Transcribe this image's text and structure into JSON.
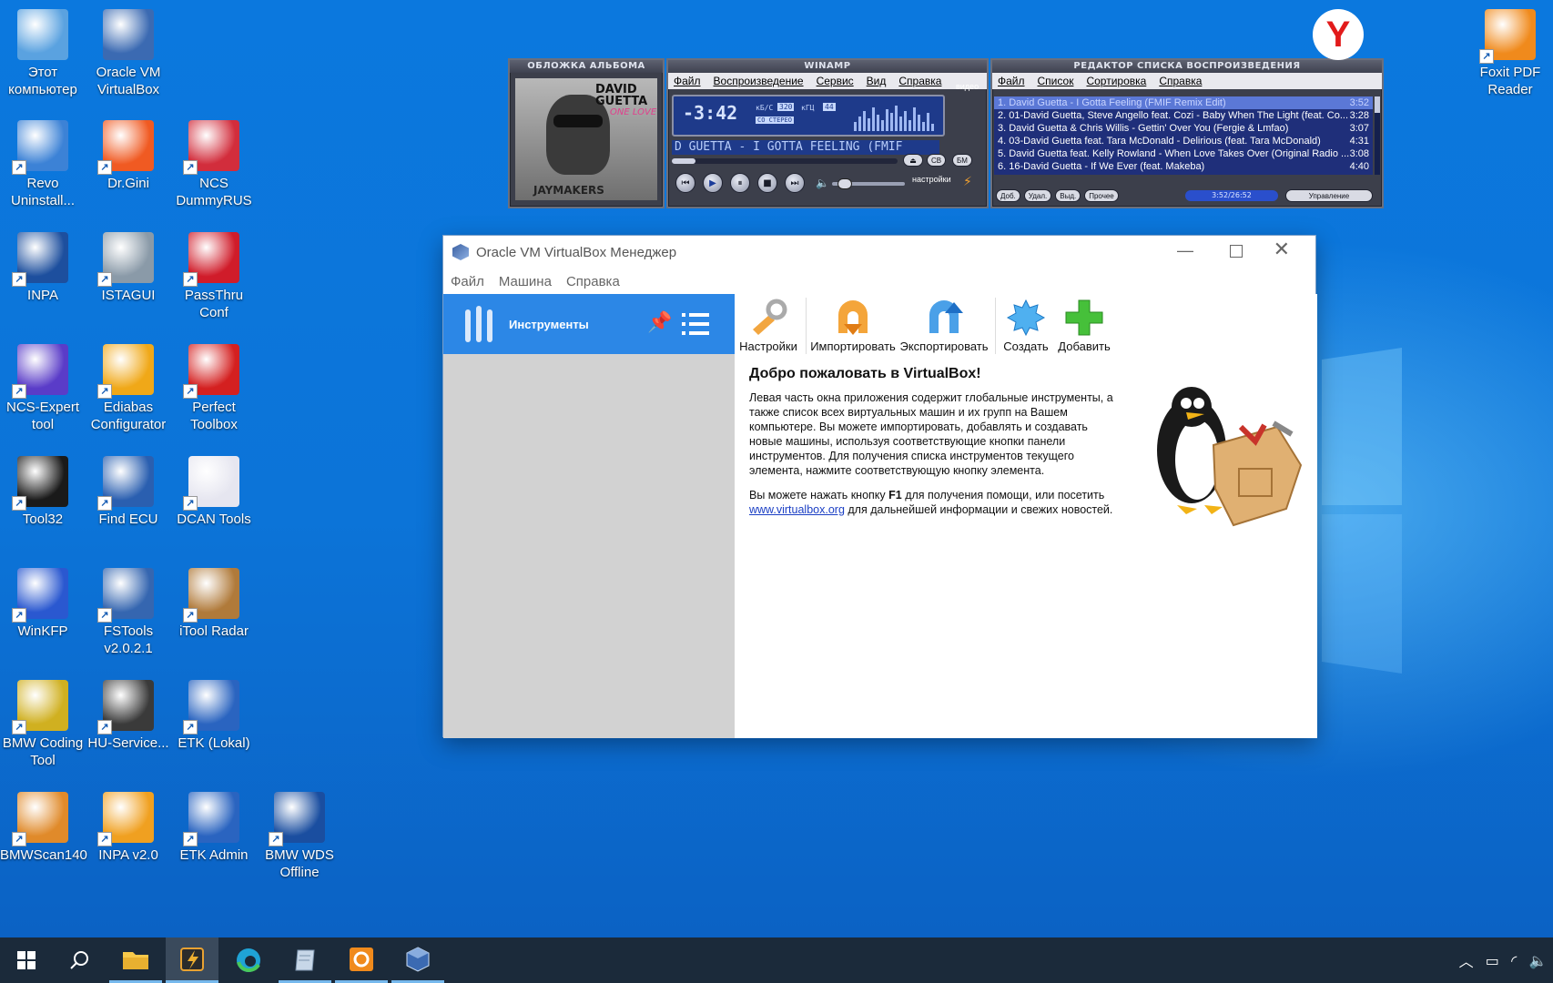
{
  "desktop": {
    "icons": [
      {
        "label": "Этот компьютер",
        "name": "this-pc"
      },
      {
        "label": "Oracle VM VirtualBox",
        "name": "virtualbox"
      },
      {
        "label": "Revo Uninstall...",
        "name": "revo-uninstaller"
      },
      {
        "label": "Dr.Gini",
        "name": "dr-gini"
      },
      {
        "label": "NCS DummyRUS",
        "name": "ncs-dummy"
      },
      {
        "label": "INPA",
        "name": "inpa"
      },
      {
        "label": "ISTAGUI",
        "name": "istagui"
      },
      {
        "label": "PassThru Conf",
        "name": "passthru-conf"
      },
      {
        "label": "NCS-Expert tool",
        "name": "ncs-expert"
      },
      {
        "label": "Ediabas Configurator",
        "name": "ediabas-configurator"
      },
      {
        "label": "Perfect Toolbox",
        "name": "perfect-toolbox"
      },
      {
        "label": "Tool32",
        "name": "tool32"
      },
      {
        "label": "Find ECU",
        "name": "find-ecu"
      },
      {
        "label": "DCAN Tools",
        "name": "dcan-tools"
      },
      {
        "label": "WinKFP",
        "name": "winkfp"
      },
      {
        "label": "FSTools v2.0.2.1",
        "name": "fstools"
      },
      {
        "label": "iTool Radar",
        "name": "itool-radar"
      },
      {
        "label": "BMW Coding Tool",
        "name": "bmw-coding-tool"
      },
      {
        "label": "HU-Service...",
        "name": "hu-service"
      },
      {
        "label": "ETK (Lokal)",
        "name": "etk-lokal"
      },
      {
        "label": "BMWScan140",
        "name": "bmwscan140"
      },
      {
        "label": "INPA v2.0",
        "name": "inpa-v2"
      },
      {
        "label": "ETK Admin",
        "name": "etk-admin"
      },
      {
        "label": "BMW WDS Offline",
        "name": "bmw-wds-offline"
      },
      {
        "label": "Foxit PDF Reader",
        "name": "foxit-pdf-reader"
      }
    ]
  },
  "winamp": {
    "album_title": "ОБЛОЖКА АЛЬБОМА",
    "album_art_text": "DAVID GUETTA",
    "album_art_sub": "ONE LOVE",
    "album_art_bottom": "JAYMAKERS",
    "main_title": "WINAMP",
    "menu": [
      "Файл",
      "Воспроизведение",
      "Сервис",
      "Вид",
      "Справка"
    ],
    "time": "-3:42",
    "kbps": "320",
    "khz": "44",
    "stereo": "СО СТЕРЕО",
    "kbps_label": "кБ/С",
    "khz_label": "кГЦ",
    "marquee": "D GUETTA - I GOTTA FEELING (FMIF",
    "video_label": "видео",
    "settings_label": "настройки",
    "btn_cb": "СВ",
    "btn_bm": "БМ",
    "playlist_title": "РЕДАКТОР СПИСКА ВОСПРОИЗВЕДЕНИЯ",
    "playlist_menu": [
      "Файл",
      "Список",
      "Сортировка",
      "Справка"
    ],
    "playlist": [
      {
        "title": "1. David Guetta - I Gotta Feeling (FMIF Remix Edit)",
        "time": "3:52"
      },
      {
        "title": "2. 01-David Guetta, Steve Angello feat. Cozi - Baby When The Light (feat. Co...",
        "time": "3:28"
      },
      {
        "title": "3. David Guetta & Chris Willis - Gettin' Over You (Fergie & Lmfao)",
        "time": "3:07"
      },
      {
        "title": "4. 03-David Guetta feat. Tara McDonald - Delirious (feat. Tara McDonald)",
        "time": "4:31"
      },
      {
        "title": "5. David Guetta feat. Kelly Rowland - When Love Takes Over (Original Radio ...",
        "time": "3:08"
      },
      {
        "title": "6. 16-David Guetta - If We Ever (feat. Makeba)",
        "time": "4:40"
      }
    ],
    "pl_buttons": {
      "add": "Доб.",
      "remove": "Удал.",
      "select": "Выд.",
      "misc": "Прочее",
      "manage": "Управление"
    },
    "pl_total": "3:52/26:52"
  },
  "vbox": {
    "title": "Oracle VM VirtualBox Менеджер",
    "menu": [
      "Файл",
      "Машина",
      "Справка"
    ],
    "tools_label": "Инструменты",
    "toolbar": [
      "Настройки",
      "Импортировать",
      "Экспортировать",
      "Создать",
      "Добавить"
    ],
    "heading": "Добро пожаловать в VirtualBox!",
    "para1": "Левая часть окна приложения содержит глобальные инструменты, а также список всех виртуальных машин и их групп на Вашем компьютере. Вы можете импортировать, добавлять и создавать новые машины, используя соответствующие кнопки панели инструментов. Для получения списка инструментов текущего элемента, нажмите соответствующую кнопку элемента.",
    "para2_a": "Вы можете нажать кнопку ",
    "para2_key": "F1",
    "para2_b": " для получения помощи, или посетить ",
    "para2_link": "www.virtualbox.org",
    "para2_c": " для дальнейшей информации и свежих новостей."
  },
  "taskbar": {
    "items": [
      "start",
      "search",
      "file-explorer",
      "winamp",
      "edge",
      "notepad",
      "foxit",
      "virtualbox"
    ]
  },
  "colors": {
    "desktop": "#0b74d8",
    "taskbar": "#1b2a3a",
    "vbox_accent": "#2c87e6"
  }
}
